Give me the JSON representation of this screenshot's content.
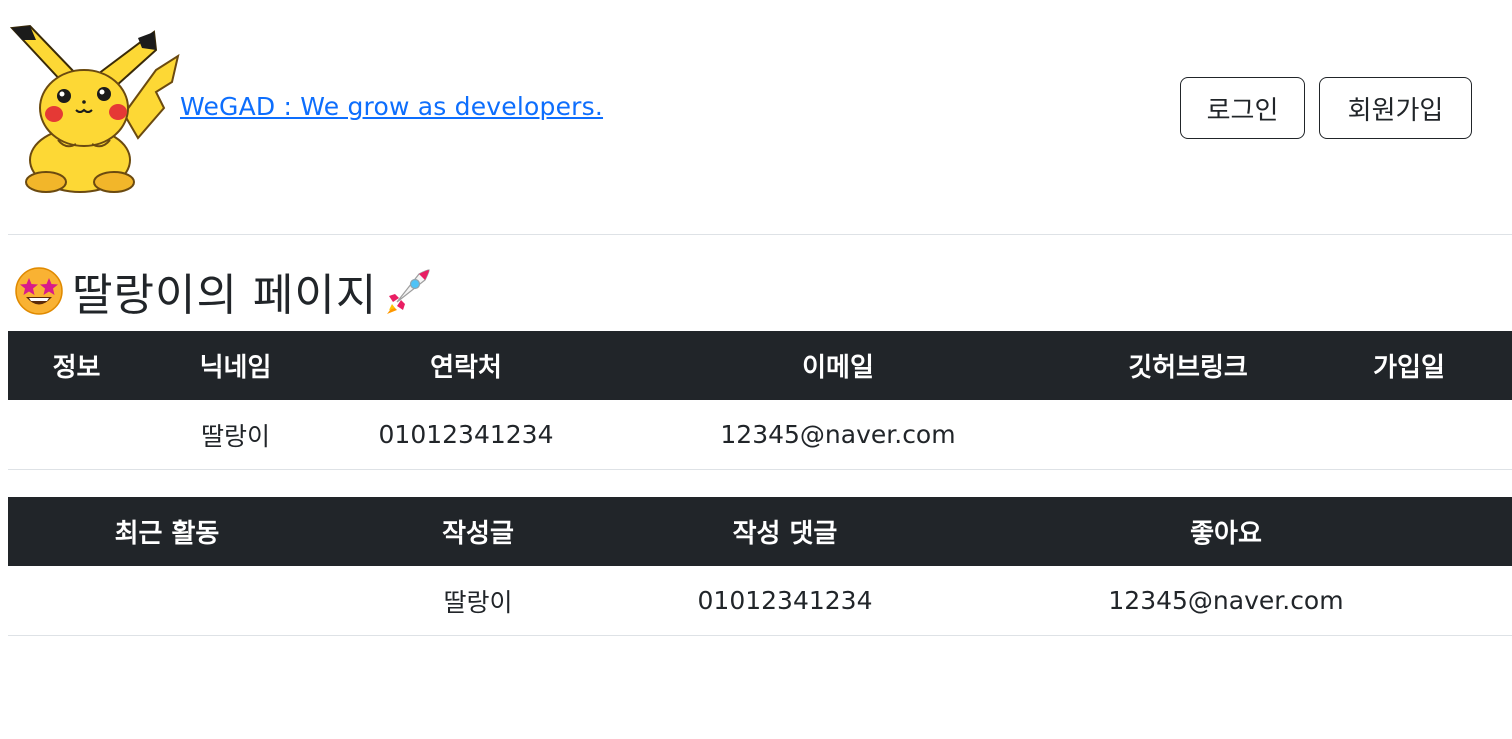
{
  "header": {
    "site_link": " WeGAD : We grow as developers.",
    "login_label": "로그인",
    "signup_label": "회원가입"
  },
  "page": {
    "title": "딸랑이의 페이지"
  },
  "info_table": {
    "headers": [
      "정보",
      "닉네임",
      "연락처",
      "이메일",
      "깃허브링크",
      "가입일"
    ],
    "row": [
      "",
      "딸랑이",
      "01012341234",
      "12345@naver.com",
      "",
      ""
    ]
  },
  "activity_table": {
    "headers": [
      "최근 활동",
      "작성글",
      "작성 댓글",
      "좋아요"
    ],
    "row": [
      "",
      "딸랑이",
      "01012341234",
      "12345@naver.com"
    ]
  },
  "icons": {
    "logo": "pikachu-logo",
    "title_left": "star-struck-emoji-icon",
    "title_right": "rocket-icon"
  },
  "colors": {
    "link": "#0d6efd",
    "table_header_bg": "#212529",
    "logo_yellow": "#fdd835"
  }
}
